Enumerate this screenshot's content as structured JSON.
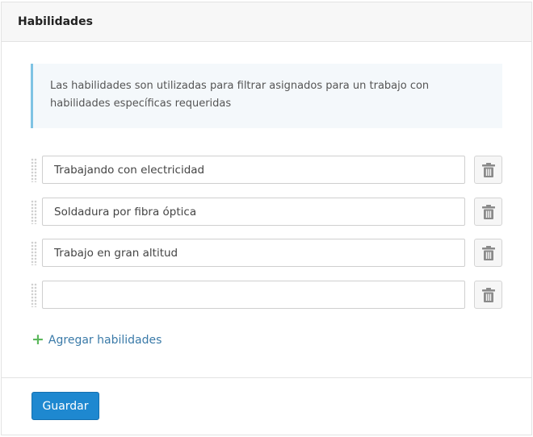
{
  "panel": {
    "title": "Habilidades"
  },
  "info": {
    "text": "Las habilidades son utilizadas para filtrar asignados para un trabajo con habilidades específicas requeridas"
  },
  "skills": [
    {
      "value": "Trabajando con electricidad"
    },
    {
      "value": "Soldadura por fibra óptica"
    },
    {
      "value": "Trabajo en gran altitud"
    },
    {
      "value": ""
    }
  ],
  "icons": {
    "drag": "drag-handle-icon",
    "delete": "trash-icon",
    "add": "plus-icon"
  },
  "actions": {
    "add_skills_label": "Agregar habilidades",
    "save_label": "Guardar"
  },
  "colors": {
    "accent": "#1e88d0",
    "info_border": "#7fc3e3",
    "add_plus": "#5cb85c",
    "link": "#3a7aa8"
  }
}
